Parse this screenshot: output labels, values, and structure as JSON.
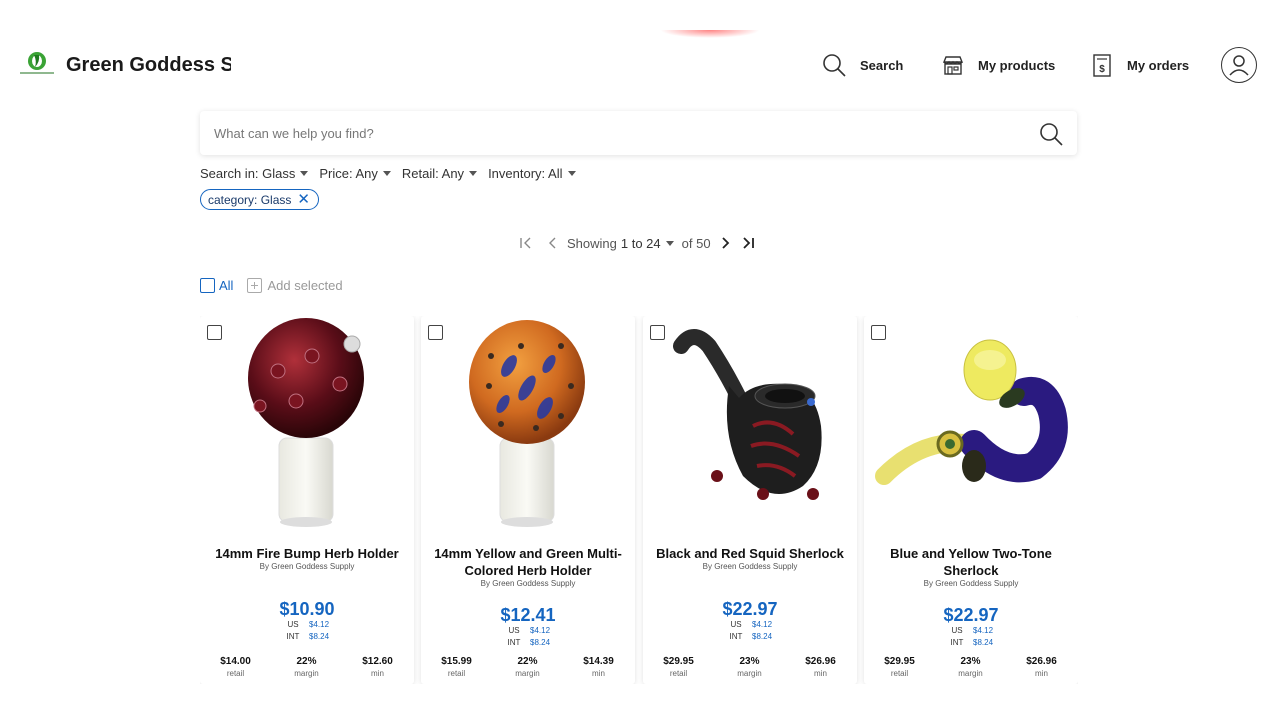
{
  "header": {
    "brand": "Green Goddess Su...",
    "search_label": "Search",
    "products_label": "My products",
    "orders_label": "My orders"
  },
  "search": {
    "placeholder": "What can we help you find?"
  },
  "filters": [
    {
      "label": "Search in: Glass"
    },
    {
      "label": "Price: Any"
    },
    {
      "label": "Retail: Any"
    },
    {
      "label": "Inventory: All"
    }
  ],
  "chip": {
    "label": "category: Glass"
  },
  "pagination": {
    "showing": "Showing",
    "range": "1 to 24",
    "of": "of 50"
  },
  "selection": {
    "all_label": "All",
    "add_selected_label": "Add selected"
  },
  "colors": {
    "accent": "#1565c0",
    "text": "#222222"
  },
  "products": [
    {
      "title": "14mm Fire Bump Herb Holder",
      "by": "By Green Goddess Supply",
      "price": "$10.90",
      "us_label": "US",
      "us_value": "$4.12",
      "int_label": "INT",
      "int_value": "$8.24",
      "retail": "$14.00",
      "retail_label": "retail",
      "margin": "22%",
      "margin_label": "margin",
      "min": "$12.60",
      "min_label": "min"
    },
    {
      "title": "14mm Yellow and Green Multi-Colored Herb Holder",
      "by": "By Green Goddess Supply",
      "price": "$12.41",
      "us_label": "US",
      "us_value": "$4.12",
      "int_label": "INT",
      "int_value": "$8.24",
      "retail": "$15.99",
      "retail_label": "retail",
      "margin": "22%",
      "margin_label": "margin",
      "min": "$14.39",
      "min_label": "min"
    },
    {
      "title": "Black and Red Squid Sherlock",
      "by": "By Green Goddess Supply",
      "price": "$22.97",
      "us_label": "US",
      "us_value": "$4.12",
      "int_label": "INT",
      "int_value": "$8.24",
      "retail": "$29.95",
      "retail_label": "retail",
      "margin": "23%",
      "margin_label": "margin",
      "min": "$26.96",
      "min_label": "min"
    },
    {
      "title": "Blue and Yellow Two-Tone Sherlock",
      "by": "By Green Goddess Supply",
      "price": "$22.97",
      "us_label": "US",
      "us_value": "$4.12",
      "int_label": "INT",
      "int_value": "$8.24",
      "retail": "$29.95",
      "retail_label": "retail",
      "margin": "23%",
      "margin_label": "margin",
      "min": "$26.96",
      "min_label": "min"
    }
  ]
}
